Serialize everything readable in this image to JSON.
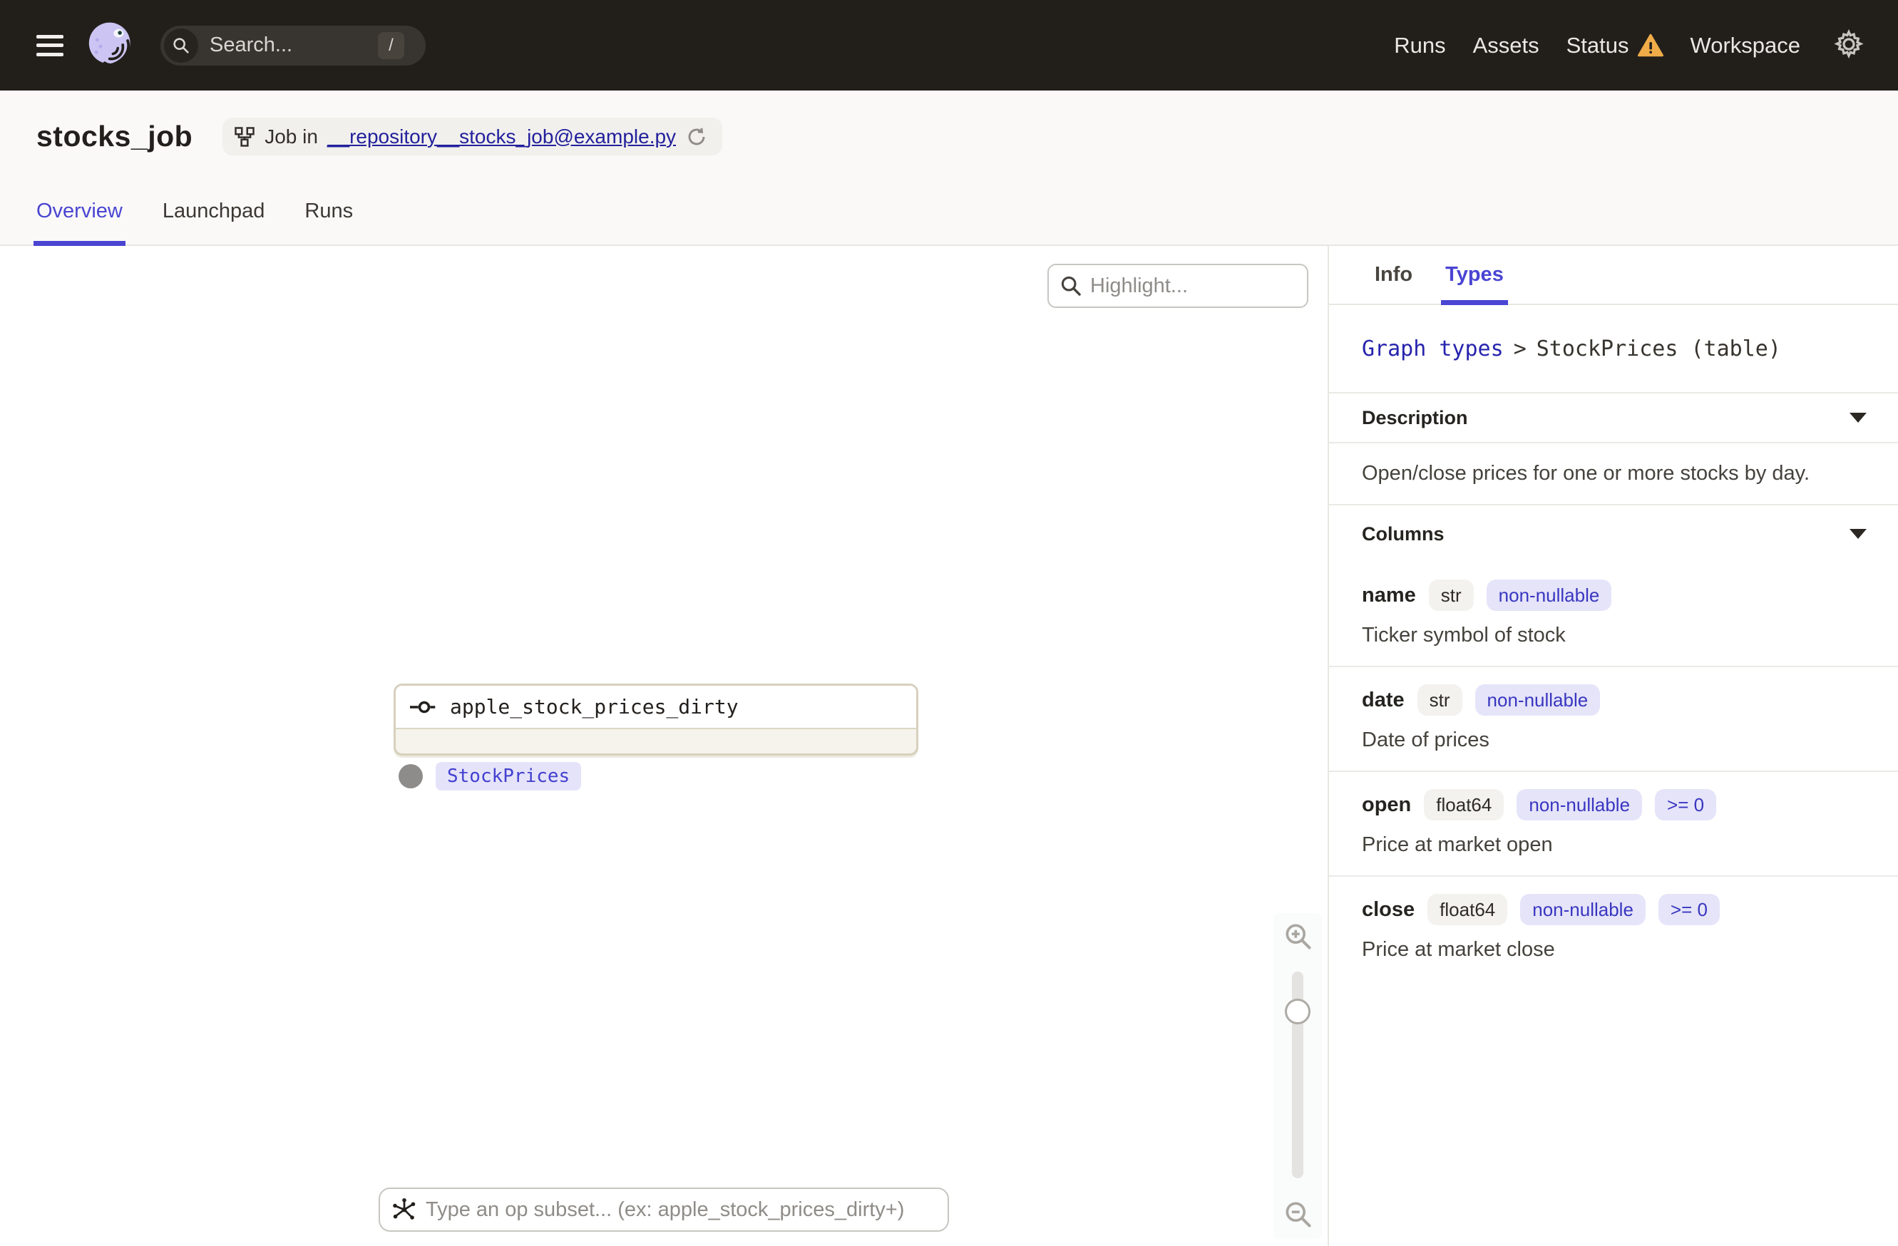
{
  "topbar": {
    "search_placeholder": "Search...",
    "search_shortcut": "/",
    "nav": [
      {
        "label": "Runs"
      },
      {
        "label": "Assets"
      },
      {
        "label": "Status",
        "warning": true
      },
      {
        "label": "Workspace"
      }
    ]
  },
  "header": {
    "title": "stocks_job",
    "badge": {
      "prefix": "Job in",
      "link": "__repository__stocks_job@example.py"
    },
    "tabs": [
      {
        "label": "Overview",
        "active": true
      },
      {
        "label": "Launchpad",
        "active": false
      },
      {
        "label": "Runs",
        "active": false
      }
    ]
  },
  "canvas": {
    "highlight_placeholder": "Highlight...",
    "node": {
      "label": "apple_stock_prices_dirty",
      "output_tag": "StockPrices"
    },
    "op_subset_placeholder": "Type an op subset... (ex: apple_stock_prices_dirty+)"
  },
  "sidebar": {
    "tabs": [
      {
        "label": "Info",
        "active": false
      },
      {
        "label": "Types",
        "active": true
      }
    ],
    "breadcrumb": {
      "link": "Graph types",
      "separator": ">",
      "current": "StockPrices (table)"
    },
    "sections": {
      "description": {
        "title": "Description",
        "text": "Open/close prices for one or more stocks by day."
      },
      "columns": {
        "title": "Columns",
        "items": [
          {
            "name": "name",
            "type": "str",
            "badges": [
              "non-nullable"
            ],
            "description": "Ticker symbol of stock"
          },
          {
            "name": "date",
            "type": "str",
            "badges": [
              "non-nullable"
            ],
            "description": "Date of prices"
          },
          {
            "name": "open",
            "type": "float64",
            "badges": [
              "non-nullable",
              ">= 0"
            ],
            "description": "Price at market open"
          },
          {
            "name": "close",
            "type": "float64",
            "badges": [
              "non-nullable",
              ">= 0"
            ],
            "description": "Price at market close"
          }
        ]
      }
    }
  },
  "colors": {
    "accent": "#4a45d2",
    "link_navy": "#23219c",
    "badge_blue_bg": "#e5e4f9",
    "badge_blue_text": "#3936c0",
    "warning_amber": "#f0ac49",
    "topbar_bg": "#221f1b"
  }
}
